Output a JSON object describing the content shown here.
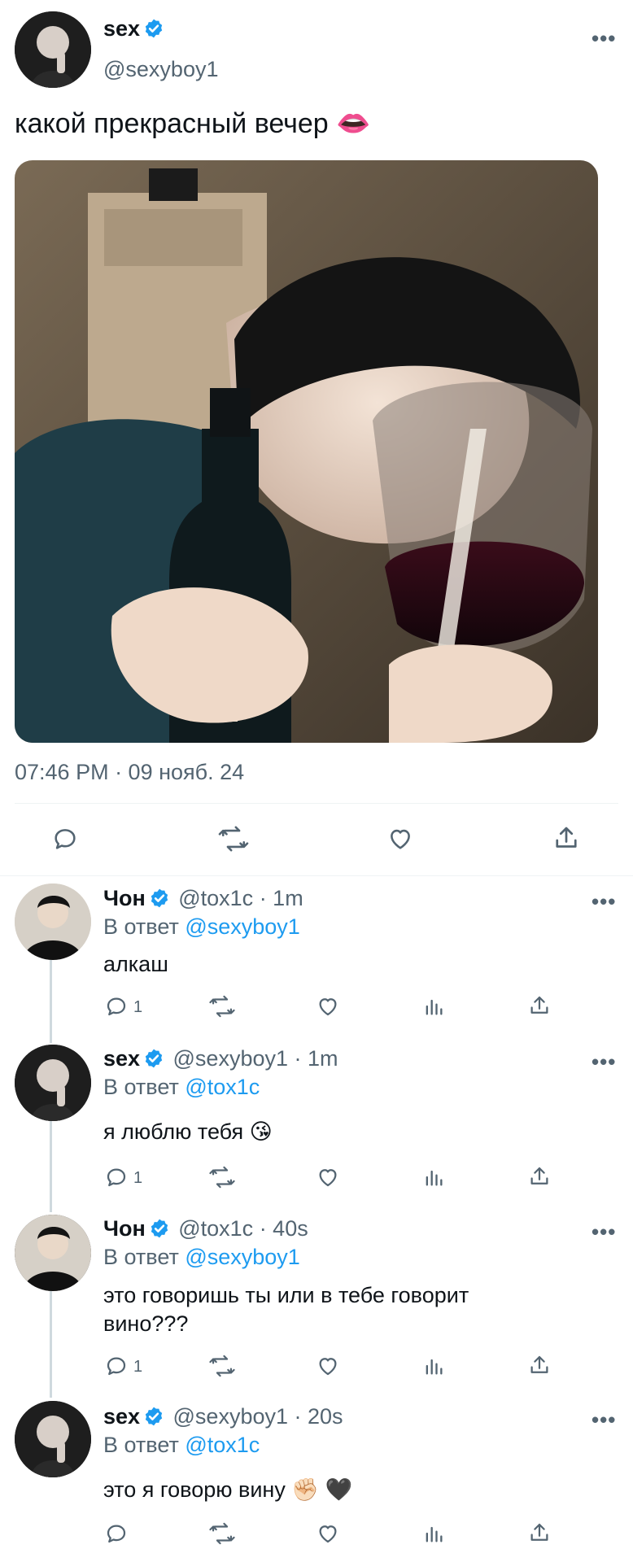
{
  "main_tweet": {
    "display_name": "sex",
    "handle": "@sexyboy1",
    "more": "•••",
    "text": "какой прекрасный вечер 👄",
    "timestamp": "07:46 PM · 09 нояб. 24"
  },
  "replies": [
    {
      "display_name": "Чон",
      "handle": "@tox1c",
      "time": " · 1m",
      "reply_prefix": "В ответ ",
      "reply_to": "@sexyboy1",
      "text": "алкаш",
      "reply_count": "1",
      "more": "•••"
    },
    {
      "display_name": "sex",
      "handle": "@sexyboy1",
      "time": " · 1m",
      "reply_prefix": "В ответ ",
      "reply_to": "@tox1c",
      "text": "я люблю тебя 😘",
      "reply_count": "1",
      "more": "•••"
    },
    {
      "display_name": "Чон",
      "handle": "@tox1c",
      "time": " · 40s",
      "reply_prefix": "В ответ ",
      "reply_to": "@sexyboy1",
      "text_line1": "это говоришь ты или в тебе говорит",
      "text_line2": "вино???",
      "reply_count": "1",
      "more": "•••"
    },
    {
      "display_name": "sex",
      "handle": "@sexyboy1",
      "time": " · 20s",
      "reply_prefix": "В ответ ",
      "reply_to": "@tox1c",
      "text": "это я говорю вину ✊🏻 🖤",
      "more": "•••"
    }
  ],
  "colors": {
    "accent": "#1d9bf0",
    "muted": "#536471",
    "text": "#0f1419",
    "divider": "#eff3f4"
  },
  "icons": [
    "verified-badge-icon",
    "reply-icon",
    "retweet-icon",
    "like-icon",
    "share-icon",
    "analytics-icon",
    "more-icon"
  ]
}
